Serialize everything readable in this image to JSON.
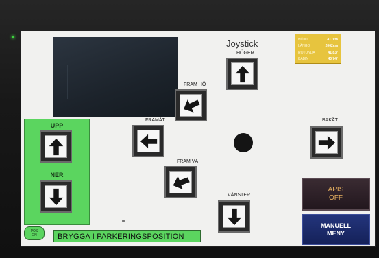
{
  "screen": {
    "title": "Joystick",
    "info_panel": [
      {
        "label": "HÖJD",
        "value": "417cm"
      },
      {
        "label": "LÄNGD",
        "value": "2062cm"
      },
      {
        "label": "ROTUNDA",
        "value": "41.83°"
      },
      {
        "label": "KABIN",
        "value": "40.74°"
      }
    ]
  },
  "joystick": {
    "hoger": "HÖGER",
    "fram_ho": "FRAM HÖ",
    "framat": "FRAMÅT",
    "bakat": "BAKÅT",
    "fram_va": "FRAM VÄ",
    "vanster": "VÄNSTER"
  },
  "lift": {
    "upp": "UPP",
    "ner": "NER"
  },
  "status": {
    "box_line1": "POS",
    "box_line2": "ON",
    "message": "BRYGGA I PARKERINGSPOSITION"
  },
  "buttons": {
    "apis_line1": "APIS",
    "apis_line2": "OFF",
    "manuell_line1": "MANUELL",
    "manuell_line2": "MENY"
  },
  "colors": {
    "green_panel": "#5bd55f",
    "info_panel": "#e7c43e",
    "apis_text": "#e6b060",
    "manuell_bg": "#23347b"
  }
}
